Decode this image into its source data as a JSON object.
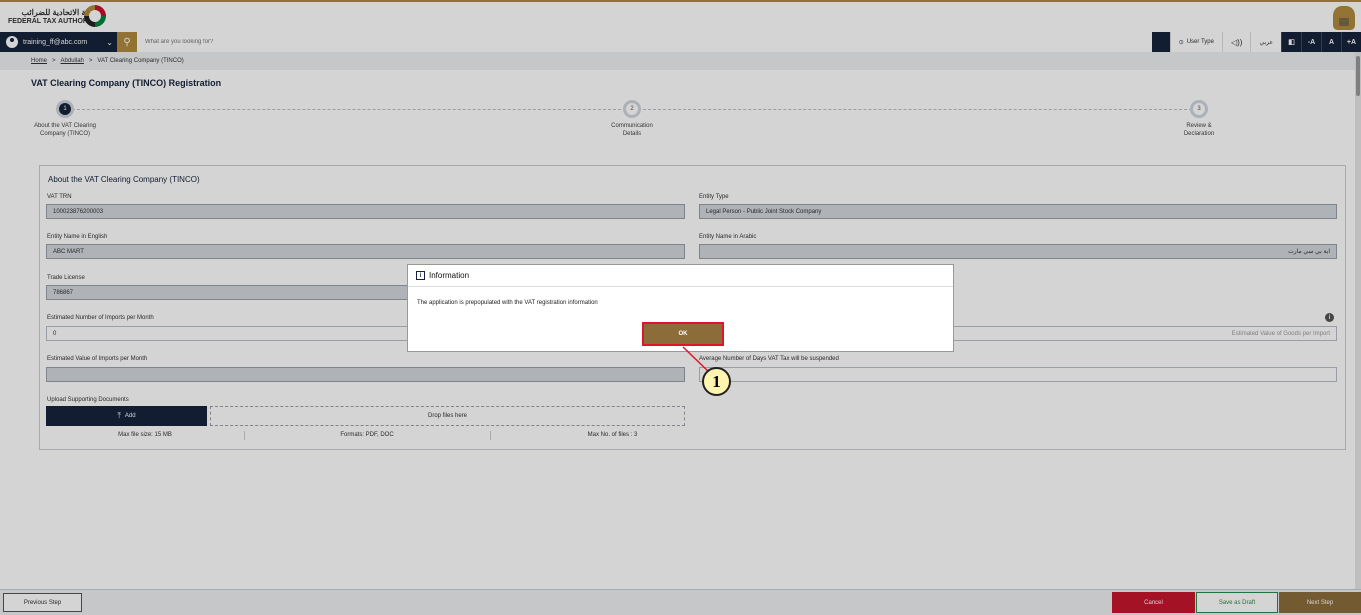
{
  "header": {
    "logo_arabic": "الهيئة الاتحادية للضرائب",
    "logo_english": "FEDERAL TAX AUTHORITY"
  },
  "navbar": {
    "user_email": "training_ff@abc.com",
    "search_placeholder": "What are you looking for?",
    "user_type_label": "User Type",
    "arabic_label": "عربي",
    "font_decrease": "-A",
    "font_normal": "A",
    "font_increase": "+A"
  },
  "breadcrumb": {
    "home": "Home",
    "user": "Abdullah",
    "current": "VAT Clearing Company (TINCO)",
    "separator": ">"
  },
  "page_title": "VAT Clearing Company (TINCO) Registration",
  "steps": [
    {
      "number": "1",
      "label": "About the VAT Clearing Company (TINCO)",
      "state": "active"
    },
    {
      "number": "2",
      "label": "Communication Details",
      "state": "idle"
    },
    {
      "number": "3",
      "label": "Review & Declaration",
      "state": "idle"
    }
  ],
  "form": {
    "section_title": "About the VAT Clearing Company (TINCO)",
    "vat_trn_label": "VAT TRN",
    "vat_trn_value": "100023876200003",
    "entity_type_label": "Entity Type",
    "entity_type_value": "Legal Person - Public Joint Stock Company",
    "entity_name_en_label": "Entity Name in English",
    "entity_name_en_value": "ABC MART",
    "entity_name_ar_label": "Entity Name in Arabic",
    "entity_name_ar_value": "اية بي سي مارت",
    "trade_license_label": "Trade License",
    "trade_license_value": "786867",
    "est_imports_label": "Estimated Number of Imports per Month",
    "est_imports_value": "0",
    "est_goods_placeholder": "Estimated Value of Goods per Import",
    "est_value_label": "Estimated Value of Imports per Month",
    "avg_days_label": "Average Number of Days VAT Tax will be suspended",
    "upload_label": "Upload Supporting Documents",
    "add_label": "Add",
    "drop_label": "Drop files here",
    "max_size": "Max file size: 15 MB",
    "formats": "Formats: PDF, DOC",
    "max_files": "Max No. of files : 3"
  },
  "modal": {
    "title": "Information",
    "message": "The application is prepopulated with the VAT registration information",
    "ok_label": "OK"
  },
  "callout": {
    "number": "1"
  },
  "footer": {
    "previous": "Previous Step",
    "cancel": "Cancel",
    "save_draft": "Save as Draft",
    "next": "Next Step"
  }
}
